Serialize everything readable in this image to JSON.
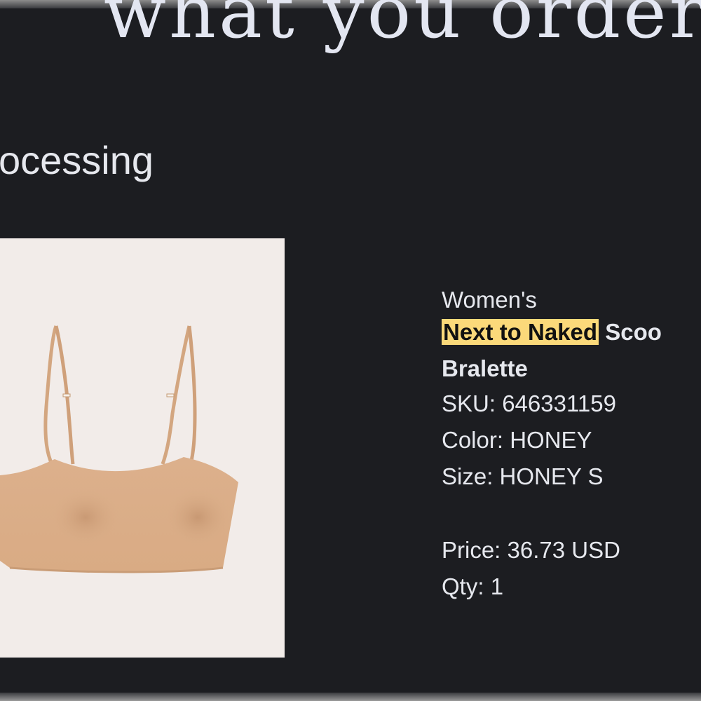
{
  "heading": "what you ordered:",
  "status": "ocessing",
  "product": {
    "category": "Women's",
    "name_highlight": "Next to Naked",
    "name_rest": " Scoo",
    "name_line2": "Bralette",
    "sku_label": "SKU:",
    "sku_value": "646331159",
    "color_label": "Color:",
    "color_value": "HONEY",
    "size_label": "Size:",
    "size_value": "HONEY S",
    "price_label": "Price:",
    "price_value": "36.73 USD",
    "qty_label": "Qty:",
    "qty_value": "1",
    "image_alt": "bralette-image"
  },
  "colors": {
    "background": "#1c1d21",
    "text": "#e6e8ee",
    "highlight": "#fbd97a",
    "product_tone": "#d9ae88"
  }
}
